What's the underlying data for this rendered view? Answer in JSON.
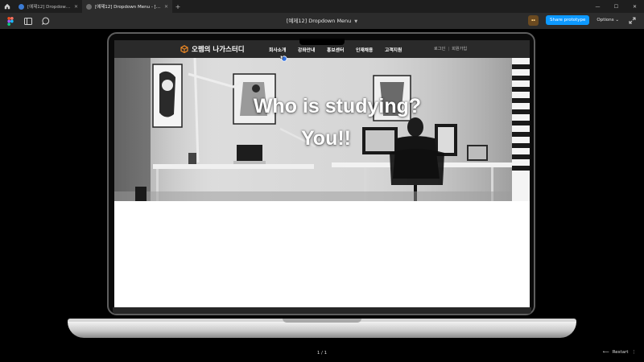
{
  "browser": {
    "tabs": [
      {
        "label": "[예제12] Dropdown Menu"
      },
      {
        "label": "[예제12] Dropdown Menu - [예제12] Dropdown..."
      }
    ],
    "new_tab": "+",
    "window_controls": [
      "—",
      "☐",
      "✕"
    ],
    "colors": {
      "tabbar_bg": "#1e1e1e",
      "active_tab_bg": "#2c2c2c"
    }
  },
  "toolbar": {
    "title": "[예제12] Dropdown Menu",
    "share_label": "Share prototype",
    "options_label": "Options",
    "icons": [
      "figma-logo-icon",
      "sidebar-toggle-icon",
      "comment-icon",
      "fullscreen-icon"
    ],
    "colors": {
      "accent": "#0d99ff",
      "bg": "#2c2c2c"
    }
  },
  "site": {
    "logo_text": "오렘의 나가스터디",
    "nav": [
      "회사소개",
      "강좌안내",
      "홍보센터",
      "인재채용",
      "고객지원"
    ],
    "util": {
      "login": "로그인",
      "separator": "|",
      "join": "회원가입"
    },
    "hero": {
      "line1": "Who is studying?",
      "line2": "You!!"
    },
    "colors": {
      "header_bg": "#2a2a2a",
      "logo_cube": "#f08a24"
    }
  },
  "footer": {
    "page_indicator": "1 / 1",
    "restart_label": "Restart"
  }
}
